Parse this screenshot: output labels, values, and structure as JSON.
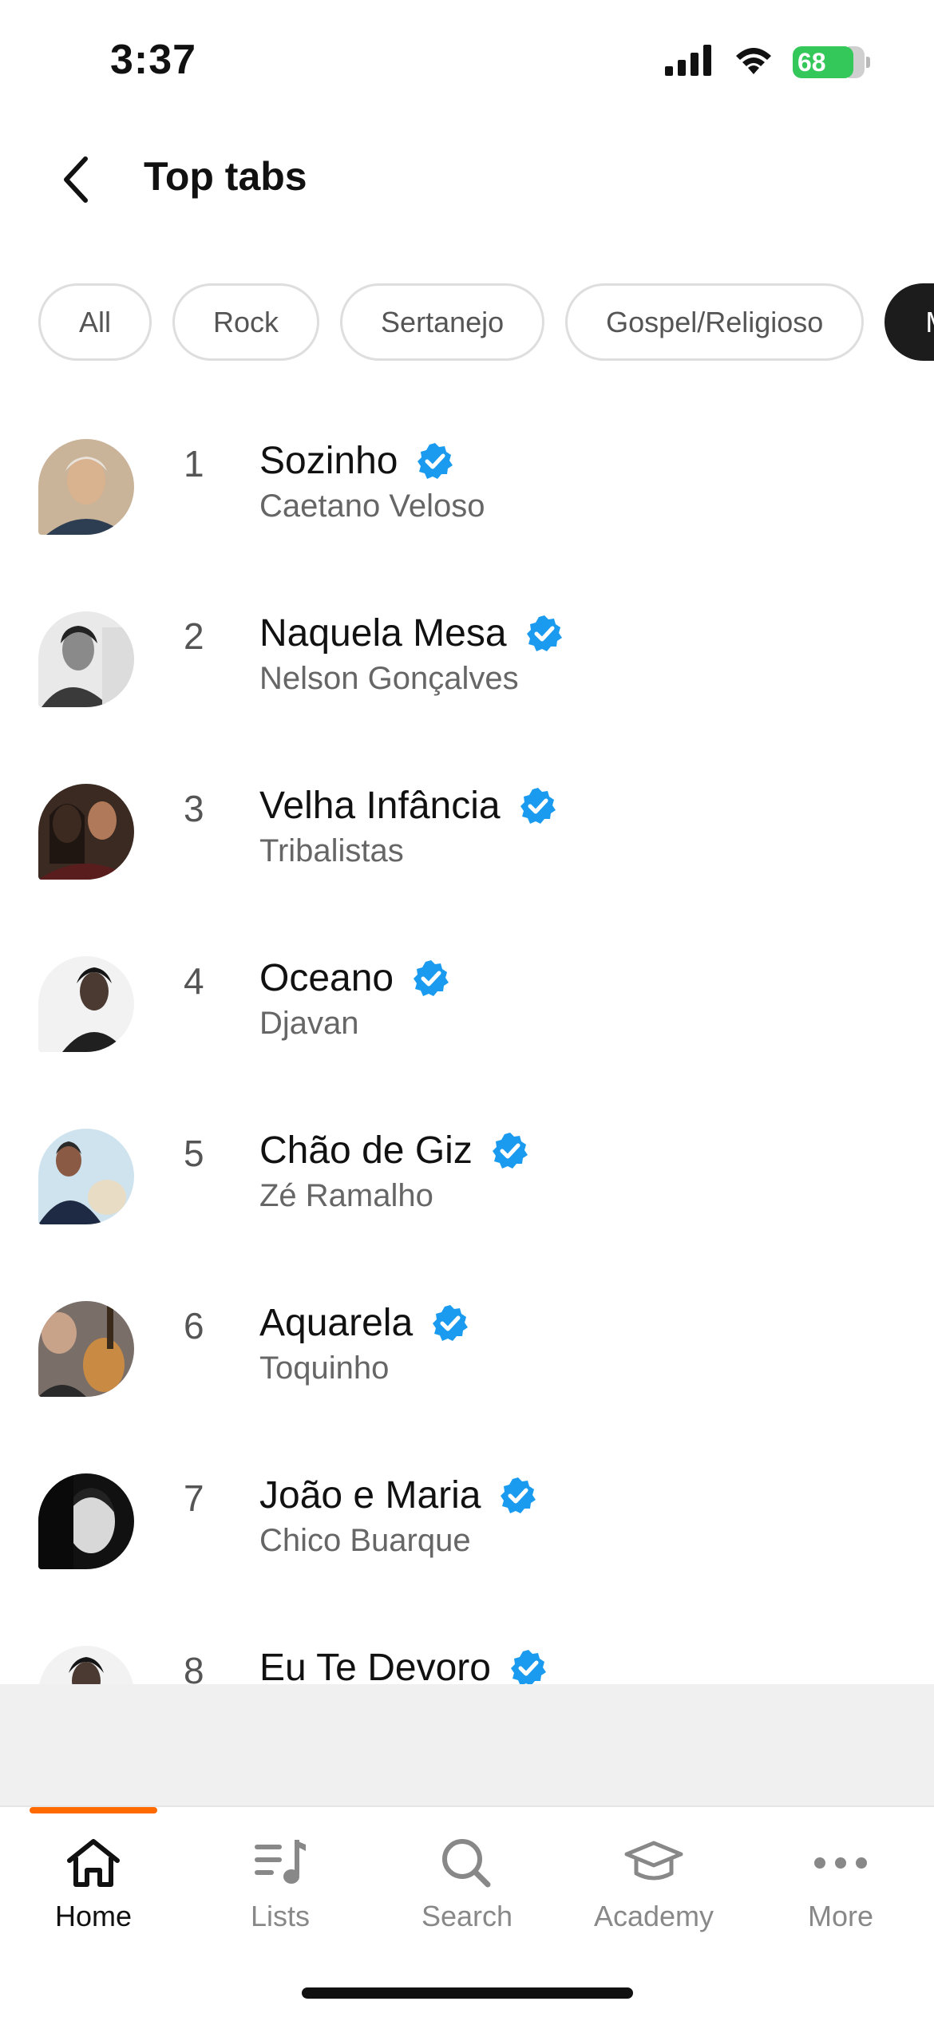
{
  "status_bar": {
    "time": "3:37",
    "battery": "68"
  },
  "header": {
    "title": "Top tabs"
  },
  "filters": [
    "All",
    "Rock",
    "Sertanejo",
    "Gospel/Religioso",
    "M"
  ],
  "tabs": [
    {
      "rank": "1",
      "title": "Sozinho",
      "artist": "Caetano Veloso"
    },
    {
      "rank": "2",
      "title": "Naquela Mesa",
      "artist": "Nelson Gonçalves"
    },
    {
      "rank": "3",
      "title": "Velha Infância",
      "artist": "Tribalistas"
    },
    {
      "rank": "4",
      "title": "Oceano",
      "artist": "Djavan"
    },
    {
      "rank": "5",
      "title": "Chão de Giz",
      "artist": "Zé Ramalho"
    },
    {
      "rank": "6",
      "title": "Aquarela",
      "artist": "Toquinho"
    },
    {
      "rank": "7",
      "title": "João e Maria",
      "artist": "Chico Buarque"
    },
    {
      "rank": "8",
      "title": "Eu Te Devoro",
      "artist": ""
    }
  ],
  "nav": {
    "home": "Home",
    "lists": "Lists",
    "search": "Search",
    "academy": "Academy",
    "more": "More"
  },
  "colors": {
    "accent": "#ff6a00",
    "verified": "#1a9bef",
    "battery": "#34c759"
  }
}
